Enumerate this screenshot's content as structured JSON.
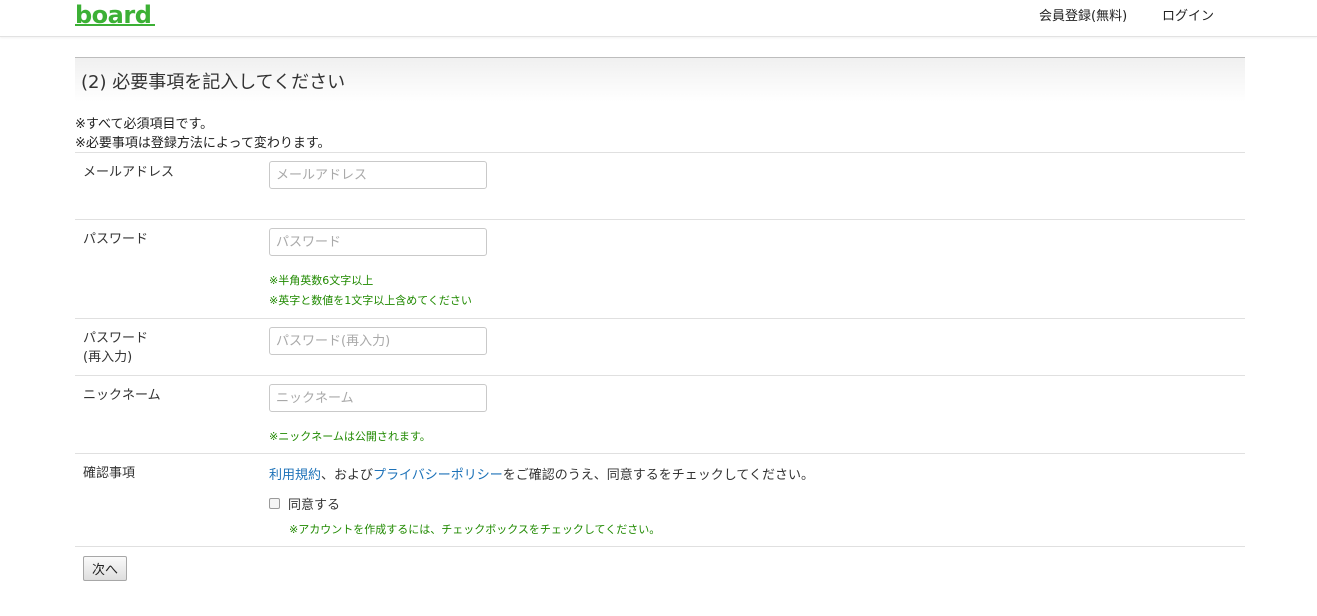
{
  "header": {
    "logo": "board",
    "nav": {
      "register": "会員登録(無料)",
      "login": "ログイン"
    }
  },
  "section": {
    "title": "(2) 必要事項を記入してください"
  },
  "notes": [
    "※すべて必須項目です。",
    "※必要事項は登録方法によって変わります。"
  ],
  "form": {
    "email": {
      "label": "メールアドレス",
      "placeholder": "メールアドレス",
      "value": ""
    },
    "password": {
      "label": "パスワード",
      "placeholder": "パスワード",
      "value": "",
      "hints": [
        "※半角英数6文字以上",
        "※英字と数値を1文字以上含めてください"
      ]
    },
    "password_confirm": {
      "label_line1": "パスワード",
      "label_line2": "(再入力)",
      "placeholder": "パスワード(再入力)",
      "value": ""
    },
    "nickname": {
      "label": "ニックネーム",
      "placeholder": "ニックネーム",
      "value": "",
      "hint": "※ニックネームは公開されます。"
    },
    "confirm": {
      "label": "確認事項",
      "terms_link": "利用規約",
      "and_text": "、および",
      "privacy_link": "プライバシーポリシー",
      "tail_text": "をご確認のうえ、同意するをチェックしてください。",
      "agree_label": "同意する",
      "agree_checked": false,
      "hint": "※アカウントを作成するには、チェックボックスをチェックしてください。"
    }
  },
  "buttons": {
    "next": "次へ"
  },
  "colors": {
    "brand": "#3cb035",
    "link": "#1d72b8",
    "hint": "#208a00"
  }
}
